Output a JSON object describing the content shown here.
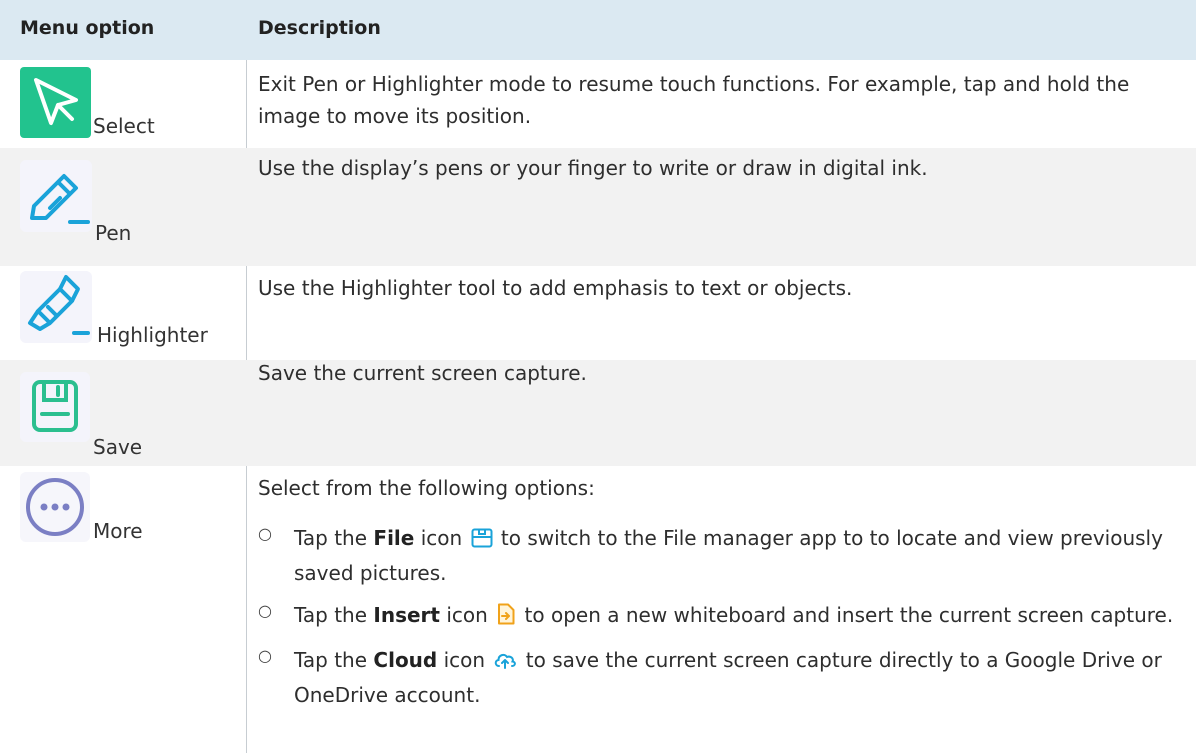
{
  "table": {
    "headers": {
      "option": "Menu option",
      "description": "Description"
    },
    "rows": [
      {
        "icon": "cursor-arrow-icon",
        "label": "Select",
        "description": "Exit Pen or Highlighter mode to resume touch functions. For example, tap and hold the image to move its position."
      },
      {
        "icon": "pen-icon",
        "label": "Pen",
        "description": "Use the display’s pens or your finger to write or draw in digital ink."
      },
      {
        "icon": "highlighter-icon",
        "label": "Highlighter",
        "description": "Use the Highlighter tool to add emphasis to text or objects."
      },
      {
        "icon": "floppy-disk-icon",
        "label": "Save",
        "description": "Save the current screen capture."
      },
      {
        "icon": "more-dots-icon",
        "label": "More",
        "description": "Select from the following options:"
      }
    ],
    "more_options": [
      {
        "before": "Tap the ",
        "bold": "File",
        "after_icon": " icon ",
        "icon": "file-save-icon",
        "text": " to switch to the File manager app to to locate and view previously saved pictures."
      },
      {
        "before": "Tap the ",
        "bold": "Insert",
        "after_icon": " icon ",
        "icon": "insert-icon",
        "text": " to open a new whiteboard and insert the current screen capture."
      },
      {
        "before": "Tap the ",
        "bold": "Cloud",
        "after_icon": " icon ",
        "icon": "cloud-upload-icon",
        "text": " to save the current screen capture directly to a Google Drive or OneDrive account."
      }
    ],
    "bullet_marker": "○"
  },
  "colors": {
    "header_bg": "#dbe9f2",
    "select_green": "#22c38e",
    "pen_blue": "#1aa3d9",
    "save_green": "#2bbf8f",
    "more_purple": "#7b7fc4",
    "insert_orange": "#f0a21a"
  }
}
